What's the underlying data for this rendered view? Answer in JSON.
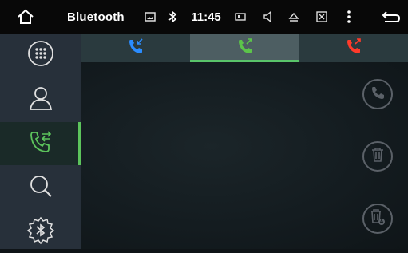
{
  "statusbar": {
    "title": "Bluetooth",
    "time": "11:45",
    "icons": [
      "home-icon",
      "image-icon",
      "bluetooth-icon",
      "screen-icon",
      "volume-icon",
      "eject-icon",
      "close-box-icon",
      "more-vert-icon",
      "back-icon"
    ]
  },
  "sidebar": {
    "items": [
      {
        "name": "dialpad",
        "icon": "dialpad-icon",
        "active": false
      },
      {
        "name": "contacts",
        "icon": "person-icon",
        "active": false
      },
      {
        "name": "call-history",
        "icon": "phone-transfer-icon",
        "active": true
      },
      {
        "name": "search",
        "icon": "search-icon",
        "active": false
      },
      {
        "name": "bluetooth-settings",
        "icon": "bluetooth-gear-icon",
        "active": false
      }
    ]
  },
  "tabs": [
    {
      "name": "incoming-calls",
      "icon": "phone-incoming-icon",
      "color": "#2a8cff",
      "active": false
    },
    {
      "name": "outgoing-calls",
      "icon": "phone-outgoing-icon",
      "color": "#5cc44a",
      "active": true
    },
    {
      "name": "missed-calls",
      "icon": "phone-missed-icon",
      "color": "#ff3a2a",
      "active": false
    }
  ],
  "actions": [
    {
      "name": "call",
      "icon": "phone-icon"
    },
    {
      "name": "delete",
      "icon": "trash-icon"
    },
    {
      "name": "delete-all",
      "icon": "trash-all-icon"
    }
  ],
  "colors": {
    "accent": "#5cc45c",
    "icon_gray": "#d8d8d8",
    "action_gray": "#5b6168"
  }
}
